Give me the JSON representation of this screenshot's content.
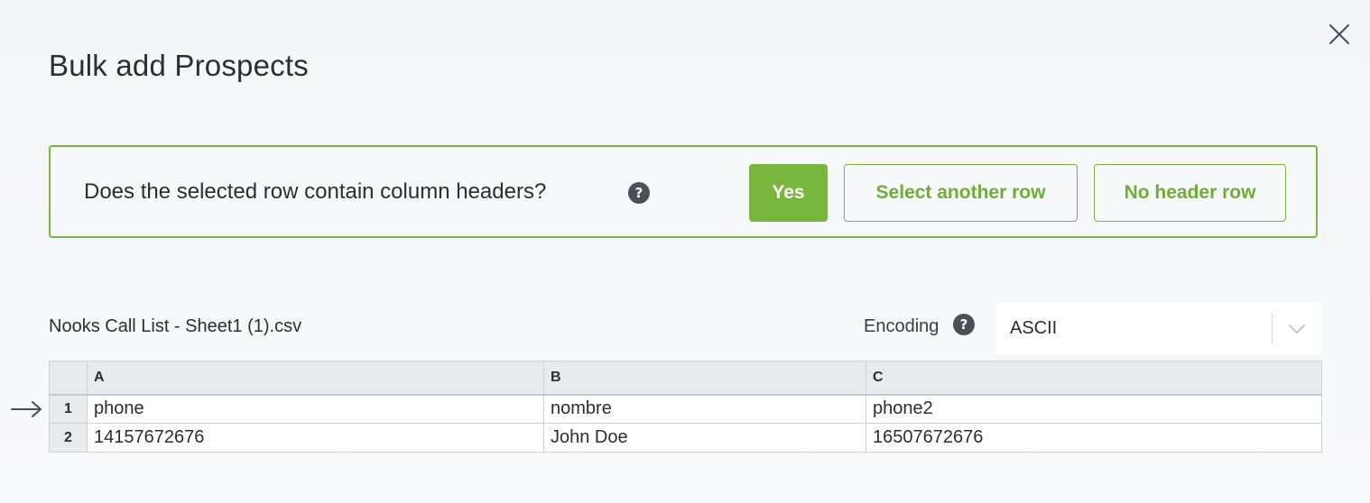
{
  "modal": {
    "title": "Bulk add Prospects",
    "close_icon": "close-icon"
  },
  "header_prompt": {
    "question": "Does the selected row contain column headers?",
    "help_icon": "question-mark-icon",
    "yes_label": "Yes",
    "select_another_label": "Select another row",
    "no_header_label": "No header row"
  },
  "file": {
    "name": "Nooks Call List - Sheet1 (1).csv"
  },
  "encoding": {
    "label": "Encoding",
    "help_icon": "question-mark-icon",
    "selected": "ASCII",
    "dropdown_icon": "chevron-down-icon"
  },
  "grid": {
    "columns": [
      "A",
      "B",
      "C"
    ],
    "selected_row_indicator_icon": "arrow-right-icon",
    "rows": [
      {
        "num": "1",
        "cells": [
          "phone",
          "nombre",
          "phone2"
        ]
      },
      {
        "num": "2",
        "cells": [
          "14157672676",
          "John Doe",
          "16507672676"
        ]
      }
    ]
  },
  "colors": {
    "accent": "#79b63e",
    "text": "#2b2d31",
    "header_bg": "#e8eaee"
  }
}
